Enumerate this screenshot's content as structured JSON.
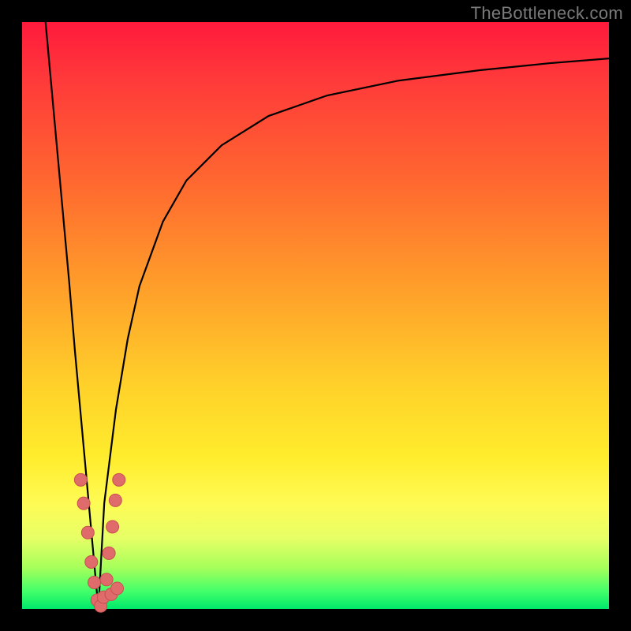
{
  "watermark": "TheBottleneck.com",
  "colors": {
    "frame": "#000000",
    "curve": "#000000",
    "dot_fill": "#e06b6b",
    "dot_stroke": "#c84f4f"
  },
  "chart_data": {
    "type": "line",
    "title": "",
    "xlabel": "",
    "ylabel": "",
    "xlim": [
      0,
      100
    ],
    "ylim": [
      0,
      100
    ],
    "series": [
      {
        "name": "left-branch",
        "x": [
          4,
          5,
          6,
          7,
          8,
          9,
          10,
          11,
          12,
          13
        ],
        "y": [
          100,
          89,
          78,
          67,
          56,
          44,
          33,
          22,
          11,
          0
        ]
      },
      {
        "name": "right-branch",
        "x": [
          13,
          14,
          16,
          18,
          20,
          24,
          28,
          34,
          42,
          52,
          64,
          78,
          90,
          100
        ],
        "y": [
          0,
          18,
          34,
          46,
          55,
          66,
          73,
          79,
          84,
          87.5,
          90,
          91.8,
          93,
          93.8
        ]
      }
    ],
    "scatter": {
      "name": "highlighted-points",
      "points": [
        {
          "x": 10.0,
          "y": 22.0
        },
        {
          "x": 10.5,
          "y": 18.0
        },
        {
          "x": 11.2,
          "y": 13.0
        },
        {
          "x": 11.8,
          "y": 8.0
        },
        {
          "x": 12.3,
          "y": 4.5
        },
        {
          "x": 12.8,
          "y": 1.5
        },
        {
          "x": 13.4,
          "y": 0.5
        },
        {
          "x": 13.9,
          "y": 2.0
        },
        {
          "x": 14.4,
          "y": 5.0
        },
        {
          "x": 14.8,
          "y": 9.5
        },
        {
          "x": 15.4,
          "y": 14.0
        },
        {
          "x": 15.9,
          "y": 18.5
        },
        {
          "x": 16.5,
          "y": 22.0
        },
        {
          "x": 15.2,
          "y": 2.5
        },
        {
          "x": 16.2,
          "y": 3.5
        }
      ]
    },
    "gradient_stops": [
      {
        "pos": 0.0,
        "color": "#ff1a3c"
      },
      {
        "pos": 0.28,
        "color": "#ff6a2f"
      },
      {
        "pos": 0.62,
        "color": "#ffd12a"
      },
      {
        "pos": 0.82,
        "color": "#fffb55"
      },
      {
        "pos": 1.0,
        "color": "#00e86b"
      }
    ]
  }
}
